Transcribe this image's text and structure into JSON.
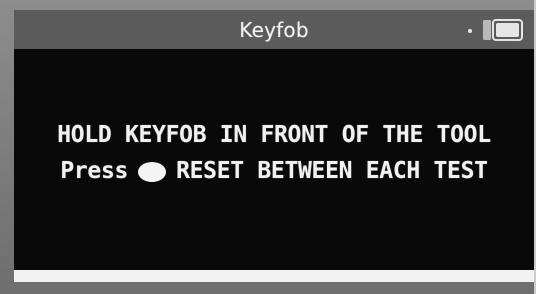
{
  "screen": {
    "title": "Keyfob",
    "status_indicators": [
      "dot-indicator",
      "battery-icon"
    ]
  },
  "message": {
    "line_1": "HOLD KEYFOB IN FRONT OF THE TOOL",
    "line_2_prefix": "Press",
    "line_2_button_icon": "round-button-icon",
    "line_2_suffix": "RESET BETWEEN EACH TEST"
  },
  "colors": {
    "screen_background": "#0b0b0b",
    "title_bar": "#5b5b5b",
    "text": "#f1f1f1",
    "bottom_bar": "#f2f2f2"
  }
}
